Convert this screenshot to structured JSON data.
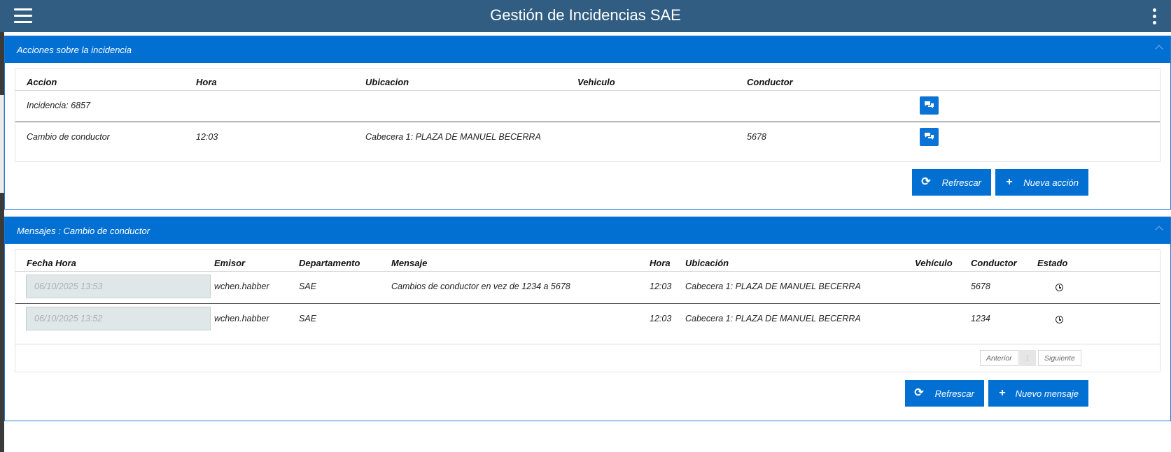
{
  "app": {
    "title": "Gestión de Incidencias SAE"
  },
  "colors": {
    "header": "#315d82",
    "accent": "#0270d2"
  },
  "acciones": {
    "header": "Acciones sobre la incidencia",
    "columns": {
      "accion": "Accion",
      "hora": "Hora",
      "ubicacion": "Ubicacion",
      "vehiculo": "Vehiculo",
      "conductor": "Conductor"
    },
    "rows": [
      {
        "accion": "Incidencia: 6857",
        "hora": "",
        "ubicacion": "",
        "vehiculo": "",
        "conductor": ""
      },
      {
        "accion": "Cambio de conductor",
        "hora": "12:03",
        "ubicacion": "Cabecera 1: PLAZA DE MANUEL BECERRA",
        "vehiculo": "",
        "conductor": "5678"
      }
    ],
    "refresh_label": "Refrescar",
    "new_label": "Nueva acción"
  },
  "mensajes": {
    "header": "Mensajes : Cambio de conductor",
    "columns": {
      "fecha": "Fecha Hora",
      "emisor": "Emisor",
      "departamento": "Departamento",
      "mensaje": "Mensaje",
      "hora": "Hora",
      "ubicacion": "Ubicación",
      "vehiculo": "Vehículo",
      "conductor": "Conductor",
      "estado": "Estado"
    },
    "rows": [
      {
        "fecha": "06/10/2025 13:53",
        "emisor": "wchen.habber",
        "departamento": "SAE",
        "mensaje": "Cambios de conductor en vez de 1234 a 5678",
        "hora": "12:03",
        "ubicacion": "Cabecera 1: PLAZA DE MANUEL BECERRA",
        "vehiculo": "",
        "conductor": "5678",
        "estado_icon": "clock-icon"
      },
      {
        "fecha": "06/10/2025 13:52",
        "emisor": "wchen.habber",
        "departamento": "SAE",
        "mensaje": "",
        "hora": "12:03",
        "ubicacion": "Cabecera 1: PLAZA DE MANUEL BECERRA",
        "vehiculo": "",
        "conductor": "1234",
        "estado_icon": "clock-icon"
      }
    ],
    "pager": {
      "prev": "Anterior",
      "page": "1",
      "next": "Siguiente"
    },
    "refresh_label": "Refrescar",
    "new_label": "Nuevo mensaje"
  }
}
